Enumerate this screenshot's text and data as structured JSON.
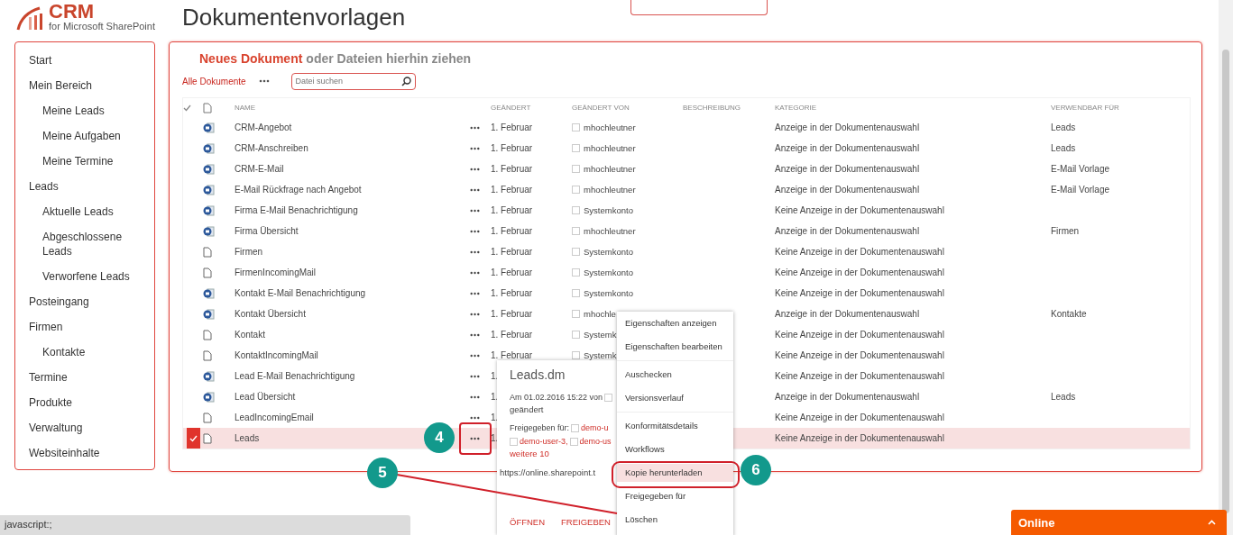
{
  "header": {
    "logo_title": "CRM",
    "logo_subtitle": "for Microsoft SharePoint",
    "page_title": "Dokumentenvorlagen"
  },
  "sidebar": {
    "items": [
      {
        "label": "Start"
      },
      {
        "label": "Mein Bereich",
        "children": [
          {
            "label": "Meine Leads"
          },
          {
            "label": "Meine Aufgaben"
          },
          {
            "label": "Meine Termine"
          }
        ]
      },
      {
        "label": "Leads",
        "children": [
          {
            "label": "Aktuelle Leads"
          },
          {
            "label": "Abgeschlossene Leads"
          },
          {
            "label": "Verworfene Leads"
          }
        ]
      },
      {
        "label": "Posteingang"
      },
      {
        "label": "Firmen",
        "children": [
          {
            "label": "Kontakte"
          }
        ]
      },
      {
        "label": "Termine"
      },
      {
        "label": "Produkte"
      },
      {
        "label": "Verwaltung"
      },
      {
        "label": "Websiteinhalte"
      }
    ]
  },
  "library": {
    "new_document": "Neues Dokument",
    "drop_hint": "oder Dateien hierhin ziehen",
    "view": "Alle Dokumente",
    "search": {
      "placeholder": "Datei suchen"
    }
  },
  "table": {
    "columns": [
      "NAME",
      "GEÄNDERT",
      "GEÄNDERT VON",
      "BESCHREIBUNG",
      "KATEGORIE",
      "VERWENDBAR FÜR"
    ],
    "rows": [
      {
        "kind": "word",
        "name": "CRM-Angebot",
        "modified": "1. Februar",
        "modified_by": "mhochleutner",
        "category": "Anzeige in der Dokumentenauswahl",
        "usable_for": "Leads",
        "selected": false
      },
      {
        "kind": "word",
        "name": "CRM-Anschreiben",
        "modified": "1. Februar",
        "modified_by": "mhochleutner",
        "category": "Anzeige in der Dokumentenauswahl",
        "usable_for": "Leads",
        "selected": false
      },
      {
        "kind": "word",
        "name": "CRM-E-Mail",
        "modified": "1. Februar",
        "modified_by": "mhochleutner",
        "category": "Anzeige in der Dokumentenauswahl",
        "usable_for": "E-Mail Vorlage",
        "selected": false
      },
      {
        "kind": "word",
        "name": "E-Mail Rückfrage nach Angebot",
        "modified": "1. Februar",
        "modified_by": "mhochleutner",
        "category": "Anzeige in der Dokumentenauswahl",
        "usable_for": "E-Mail Vorlage",
        "selected": false
      },
      {
        "kind": "word",
        "name": "Firma E-Mail Benachrichtigung",
        "modified": "1. Februar",
        "modified_by": "Systemkonto",
        "category": "Keine Anzeige in der Dokumentenauswahl",
        "selected": false
      },
      {
        "kind": "word",
        "name": "Firma Übersicht",
        "modified": "1. Februar",
        "modified_by": "mhochleutner",
        "category": "Anzeige in der Dokumentenauswahl",
        "usable_for": "Firmen",
        "selected": false
      },
      {
        "kind": "file",
        "name": "Firmen",
        "modified": "1. Februar",
        "modified_by": "Systemkonto",
        "category": "Keine Anzeige in der Dokumentenauswahl",
        "selected": false
      },
      {
        "kind": "file",
        "name": "FirmenIncomingMail",
        "modified": "1. Februar",
        "modified_by": "Systemkonto",
        "category": "Keine Anzeige in der Dokumentenauswahl",
        "selected": false
      },
      {
        "kind": "word",
        "name": "Kontakt E-Mail Benachrichtigung",
        "modified": "1. Februar",
        "modified_by": "Systemkonto",
        "category": "Keine Anzeige in der Dokumentenauswahl",
        "selected": false
      },
      {
        "kind": "word",
        "name": "Kontakt Übersicht",
        "modified": "1. Februar",
        "modified_by": "mhochle",
        "category": "Anzeige in der Dokumentenauswahl",
        "usable_for": "Kontakte",
        "selected": false
      },
      {
        "kind": "file",
        "name": "Kontakt",
        "modified": "1. Februar",
        "modified_by": "Systemk",
        "category": "Keine Anzeige in der Dokumentenauswahl",
        "selected": false
      },
      {
        "kind": "file",
        "name": "KontaktIncomingMail",
        "modified": "1. Februar",
        "modified_by": "Systemk",
        "category": "Keine Anzeige in der Dokumentenauswahl",
        "selected": false
      },
      {
        "kind": "word",
        "name": "Lead E-Mail Benachrichtigung",
        "modified": "1.",
        "category": "Keine Anzeige in der Dokumentenauswahl",
        "selected": false
      },
      {
        "kind": "word",
        "name": "Lead Übersicht",
        "modified": "1.",
        "category": "Anzeige in der Dokumentenauswahl",
        "usable_for": "Leads",
        "selected": false
      },
      {
        "kind": "file",
        "name": "LeadIncomingEmail",
        "modified": "1.",
        "category": "Keine Anzeige in der Dokumentenauswahl",
        "selected": false
      },
      {
        "kind": "file",
        "name": "Leads",
        "modified": "1.",
        "category": "Keine Anzeige in der Dokumentenauswahl",
        "selected": true
      }
    ]
  },
  "callout": {
    "title": "Leads.dm",
    "changed_prefix": "Am 01.02.2016 15:22 von",
    "changed_suffix": "geändert",
    "shared_label": "Freigegeben für:",
    "shared_users": [
      "demo-u",
      "demo-user-3,",
      "demo-us"
    ],
    "more": "weitere 10",
    "url": "https://online.sharepoint.t",
    "actions": [
      "ÖFFNEN",
      "FREIGEBEN"
    ]
  },
  "context_menu": {
    "groups": [
      [
        {
          "label": "Eigenschaften anzeigen",
          "selected": false
        },
        {
          "label": "Eigenschaften bearbeiten",
          "selected": false
        }
      ],
      [
        {
          "label": "Auschecken",
          "selected": false
        },
        {
          "label": "Versionsverlauf",
          "selected": false
        }
      ],
      [
        {
          "label": "Konformitätsdetails",
          "selected": false
        },
        {
          "label": "Workflows",
          "selected": false
        },
        {
          "label": "Kopie herunterladen",
          "selected": true
        },
        {
          "label": "Freigegeben für",
          "selected": false
        },
        {
          "label": "Löschen",
          "selected": false
        }
      ]
    ]
  },
  "annotations": [
    "4",
    "5",
    "6"
  ],
  "status_bar": {
    "text": "javascript:;"
  },
  "chat_bar": {
    "label": "Online"
  }
}
